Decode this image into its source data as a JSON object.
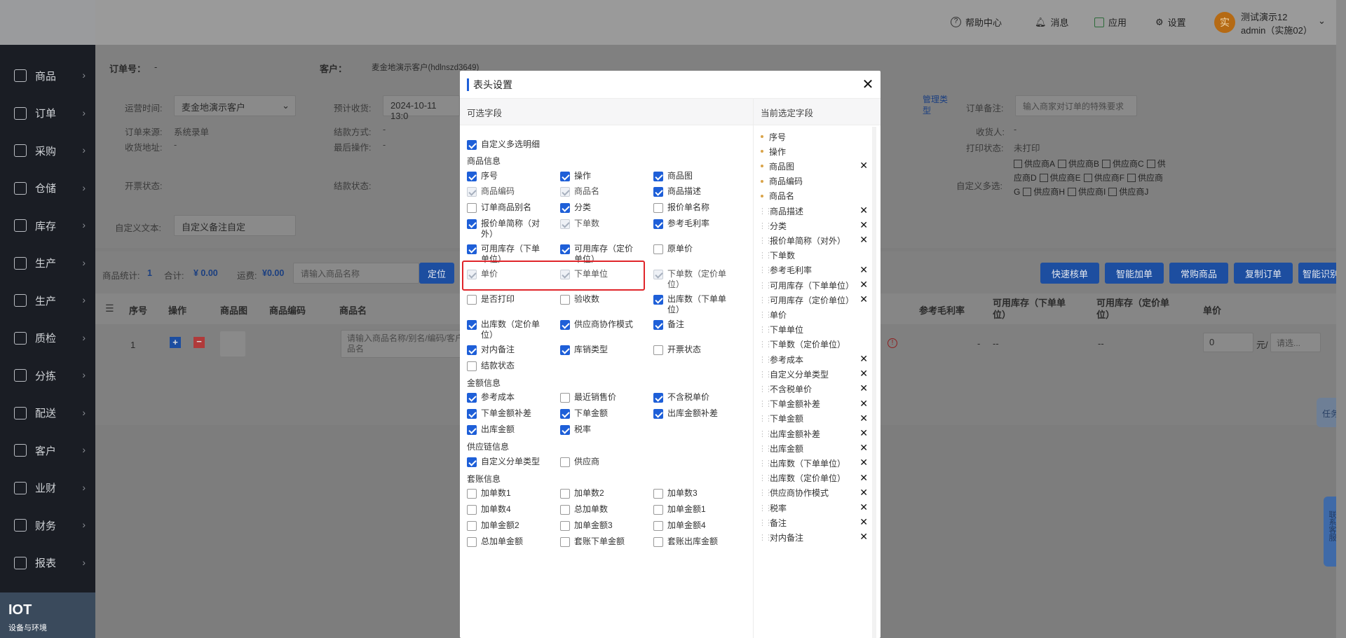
{
  "topbar": {
    "help": "帮助中心",
    "messages": "消息",
    "apps": "应用",
    "settings": "设置",
    "company": "测试演示12",
    "user": "admin（实施02）",
    "avatar_char": "实"
  },
  "sidebar": {
    "items": [
      {
        "label": "商品"
      },
      {
        "label": "订单"
      },
      {
        "label": "采购"
      },
      {
        "label": "仓储"
      },
      {
        "label": "库存"
      },
      {
        "label": "生产"
      },
      {
        "label": "生产"
      },
      {
        "label": "质检"
      },
      {
        "label": "分拣"
      },
      {
        "label": "配送"
      },
      {
        "label": "客户"
      },
      {
        "label": "业财"
      },
      {
        "label": "财务"
      },
      {
        "label": "报表"
      }
    ],
    "iot_title": "IOT",
    "iot_sub": "设备与环境"
  },
  "order": {
    "order_no_label": "订单号：",
    "order_no_value": "-",
    "customer_label": "客户：",
    "customer_value": "麦金地演示客户(hdlnszd3649)",
    "ops_time_label": "运营时间:",
    "ops_time_value": "麦金地演示客户",
    "expected_label": "预计收货:",
    "expected_value": "2024-10-11 13:0",
    "source_label": "订单来源:",
    "source_value": "系统录单",
    "settle_method_label": "结款方式:",
    "settle_method_value": "-",
    "address_label": "收货地址:",
    "address_value": "-",
    "last_op_label": "最后操作:",
    "last_op_value": "-",
    "invoice_label": "开票状态:",
    "settle_status_label": "结款状态:",
    "custom_text_label": "自定义文本:",
    "custom_text_value": "自定义备注自定",
    "manage_type": "管理类型",
    "remark_label": "订单备注:",
    "remark_placeholder": "输入商家对订单的特殊要求",
    "receiver_label": "收货人:",
    "receiver_value": "-",
    "print_label": "打印状态:",
    "print_value": "未打印",
    "multi_label": "自定义多选:",
    "suppliers": [
      "供应商A",
      "供应商B",
      "供应商C",
      "供应商D",
      "供应商E",
      "供应商F",
      "供应商G",
      "供应商H",
      "供应商I",
      "供应商J"
    ]
  },
  "stats": {
    "items_label": "商品统计:",
    "items_value": "1",
    "total_label": "合计:",
    "total_value": "¥ 0.00",
    "freight_label": "运费:",
    "freight_value": "¥0.00",
    "search_placeholder": "请输入商品名称",
    "locate": "定位",
    "buttons": [
      "快速核单",
      "智能加单",
      "常购商品",
      "复制订单",
      "智能识别"
    ]
  },
  "table": {
    "headers": [
      "序号",
      "操作",
      "商品图",
      "商品编码",
      "商品名"
    ],
    "right_headers": [
      "参考毛利率",
      "可用库存（下单单位）",
      "可用库存（定价单位）",
      "单价"
    ],
    "row_index": "1",
    "name_placeholder": "请输入商品名称/别名/编码/客户商品名",
    "price_value": "0",
    "price_unit": "元/",
    "unit_select": "请选...",
    "dash": "-",
    "dashdash": "--"
  },
  "side_float": {
    "task": "任务",
    "contact": "联系客服"
  },
  "modal": {
    "title": "表头设置",
    "left_header": "可选字段",
    "right_header": "当前选定字段",
    "top_option": {
      "label": "自定义多选明细",
      "checked": true
    },
    "sections": [
      {
        "title": "商品信息",
        "options": [
          {
            "label": "序号",
            "state": "on"
          },
          {
            "label": "操作",
            "state": "on"
          },
          {
            "label": "商品图",
            "state": "on"
          },
          {
            "label": "商品编码",
            "state": "dis"
          },
          {
            "label": "商品名",
            "state": "dis"
          },
          {
            "label": "商品描述",
            "state": "on"
          },
          {
            "label": "订单商品别名",
            "state": "off"
          },
          {
            "label": "分类",
            "state": "on"
          },
          {
            "label": "报价单名称",
            "state": "off"
          },
          {
            "label": "报价单简称（对外）",
            "state": "on"
          },
          {
            "label": "下单数",
            "state": "dis"
          },
          {
            "label": "参考毛利率",
            "state": "on"
          },
          {
            "label": "可用库存（下单单位）",
            "state": "on"
          },
          {
            "label": "可用库存（定价单位）",
            "state": "on"
          },
          {
            "label": "原单价",
            "state": "off"
          },
          {
            "label": "单价",
            "state": "dis"
          },
          {
            "label": "下单单位",
            "state": "dis"
          },
          {
            "label": "下单数（定价单位）",
            "state": "dis"
          },
          {
            "label": "是否打印",
            "state": "off"
          },
          {
            "label": "验收数",
            "state": "off"
          },
          {
            "label": "出库数（下单单位）",
            "state": "on"
          },
          {
            "label": "出库数（定价单位）",
            "state": "on"
          },
          {
            "label": "供应商协作模式",
            "state": "on"
          },
          {
            "label": "备注",
            "state": "on"
          },
          {
            "label": "对内备注",
            "state": "on"
          },
          {
            "label": "库销类型",
            "state": "on"
          },
          {
            "label": "开票状态",
            "state": "off"
          },
          {
            "label": "结款状态",
            "state": "off"
          }
        ]
      },
      {
        "title": "金额信息",
        "options": [
          {
            "label": "参考成本",
            "state": "on"
          },
          {
            "label": "最近销售价",
            "state": "off"
          },
          {
            "label": "不含税单价",
            "state": "on"
          },
          {
            "label": "下单金额补差",
            "state": "on"
          },
          {
            "label": "下单金额",
            "state": "on"
          },
          {
            "label": "出库金额补差",
            "state": "on"
          },
          {
            "label": "出库金额",
            "state": "on"
          },
          {
            "label": "税率",
            "state": "on"
          }
        ]
      },
      {
        "title": "供应链信息",
        "options": [
          {
            "label": "自定义分单类型",
            "state": "on"
          },
          {
            "label": "供应商",
            "state": "off"
          }
        ]
      },
      {
        "title": "套账信息",
        "options": [
          {
            "label": "加单数1",
            "state": "off"
          },
          {
            "label": "加单数2",
            "state": "off"
          },
          {
            "label": "加单数3",
            "state": "off"
          },
          {
            "label": "加单数4",
            "state": "off"
          },
          {
            "label": "总加单数",
            "state": "off"
          },
          {
            "label": "加单金额1",
            "state": "off"
          },
          {
            "label": "加单金额2",
            "state": "off"
          },
          {
            "label": "加单金额3",
            "state": "off"
          },
          {
            "label": "加单金额4",
            "state": "off"
          },
          {
            "label": "总加单金额",
            "state": "off"
          },
          {
            "label": "套账下单金额",
            "state": "off"
          },
          {
            "label": "套账出库金额",
            "state": "off"
          }
        ]
      }
    ],
    "selected": [
      {
        "label": "序号",
        "fixed": true
      },
      {
        "label": "操作",
        "fixed": true
      },
      {
        "label": "商品图",
        "fixed": true,
        "x": true
      },
      {
        "label": "商品编码",
        "fixed": true
      },
      {
        "label": "商品名",
        "fixed": true
      },
      {
        "label": "商品描述",
        "x": true
      },
      {
        "label": "分类",
        "x": true
      },
      {
        "label": "报价单简称（对外）",
        "x": true
      },
      {
        "label": "下单数"
      },
      {
        "label": "参考毛利率",
        "x": true
      },
      {
        "label": "可用库存（下单单位）",
        "x": true
      },
      {
        "label": "可用库存（定价单位）",
        "x": true
      },
      {
        "label": "单价"
      },
      {
        "label": "下单单位"
      },
      {
        "label": "下单数（定价单位）"
      },
      {
        "label": "参考成本",
        "x": true
      },
      {
        "label": "自定义分单类型",
        "x": true
      },
      {
        "label": "不含税单价",
        "x": true
      },
      {
        "label": "下单金额补差",
        "x": true
      },
      {
        "label": "下单金额",
        "x": true
      },
      {
        "label": "出库金额补差",
        "x": true
      },
      {
        "label": "出库金额",
        "x": true
      },
      {
        "label": "出库数（下单单位）",
        "x": true
      },
      {
        "label": "出库数（定价单位）",
        "x": true
      },
      {
        "label": "供应商协作模式",
        "x": true
      },
      {
        "label": "税率",
        "x": true
      },
      {
        "label": "备注",
        "x": true
      },
      {
        "label": "对内备注",
        "x": true
      }
    ]
  }
}
